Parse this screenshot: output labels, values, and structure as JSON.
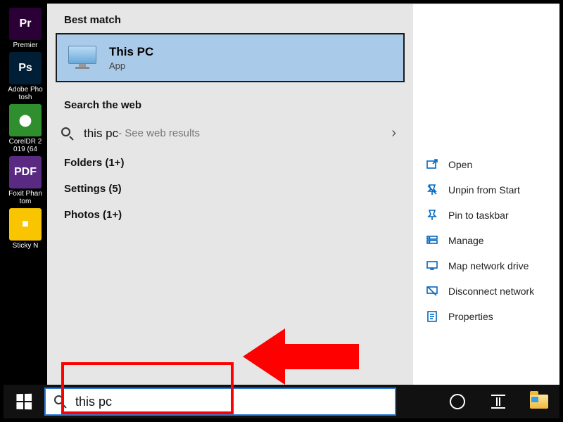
{
  "desktop_icons": [
    {
      "label": "Premier",
      "abbr": "Pr",
      "bg": "#2b0036"
    },
    {
      "label": "Adobe Photosh",
      "abbr": "Ps",
      "bg": "#001e36"
    },
    {
      "label": "CorelDR 2019 (64",
      "abbr": "⬤",
      "bg": "#2f8f2f"
    },
    {
      "label": "Foxit Phantom",
      "abbr": "PDF",
      "bg": "#5a2a82"
    },
    {
      "label": "Sticky N",
      "abbr": "■",
      "bg": "#f9c400"
    }
  ],
  "search": {
    "best_match_header": "Best match",
    "best_match": {
      "title": "This PC",
      "subtitle": "App"
    },
    "web_header": "Search the web",
    "web_query": "this pc",
    "web_suffix": " - See web results",
    "categories": [
      {
        "label": "Folders (1+)"
      },
      {
        "label": "Settings (5)"
      },
      {
        "label": "Photos (1+)"
      }
    ],
    "input_value": "this pc"
  },
  "context_menu": [
    {
      "name": "open",
      "label": "Open",
      "icon": "open"
    },
    {
      "name": "unpin-start",
      "label": "Unpin from Start",
      "icon": "unpin"
    },
    {
      "name": "pin-taskbar",
      "label": "Pin to taskbar",
      "icon": "pin"
    },
    {
      "name": "manage",
      "label": "Manage",
      "icon": "manage"
    },
    {
      "name": "map-drive",
      "label": "Map network drive",
      "icon": "map"
    },
    {
      "name": "disconnect",
      "label": "Disconnect network",
      "icon": "disconnect"
    },
    {
      "name": "properties",
      "label": "Properties",
      "icon": "properties"
    }
  ]
}
